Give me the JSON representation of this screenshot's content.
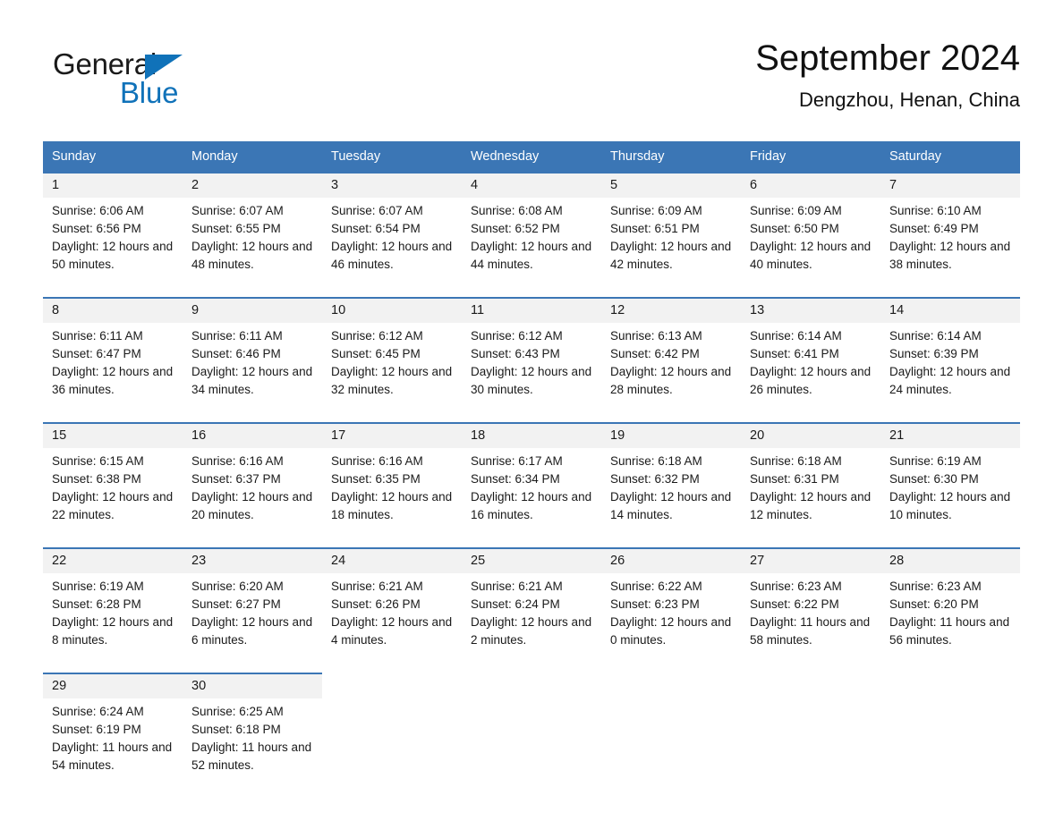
{
  "logo": {
    "word_dark": "General",
    "word_blue": "Blue",
    "triangle_color": "#1072b9"
  },
  "header": {
    "title": "September 2024",
    "subtitle": "Dengzhou, Henan, China"
  },
  "theme": {
    "header_row_bg": "#3b76b5",
    "date_cell_bg": "#f2f2f2",
    "week_rule": "#3b76b5",
    "text": "#1a1a1a"
  },
  "calendar": {
    "weekday_headers": [
      "Sunday",
      "Monday",
      "Tuesday",
      "Wednesday",
      "Thursday",
      "Friday",
      "Saturday"
    ],
    "weeks": [
      [
        {
          "day": "1",
          "sunrise": "Sunrise: 6:06 AM",
          "sunset": "Sunset: 6:56 PM",
          "daylight": "Daylight: 12 hours and 50 minutes."
        },
        {
          "day": "2",
          "sunrise": "Sunrise: 6:07 AM",
          "sunset": "Sunset: 6:55 PM",
          "daylight": "Daylight: 12 hours and 48 minutes."
        },
        {
          "day": "3",
          "sunrise": "Sunrise: 6:07 AM",
          "sunset": "Sunset: 6:54 PM",
          "daylight": "Daylight: 12 hours and 46 minutes."
        },
        {
          "day": "4",
          "sunrise": "Sunrise: 6:08 AM",
          "sunset": "Sunset: 6:52 PM",
          "daylight": "Daylight: 12 hours and 44 minutes."
        },
        {
          "day": "5",
          "sunrise": "Sunrise: 6:09 AM",
          "sunset": "Sunset: 6:51 PM",
          "daylight": "Daylight: 12 hours and 42 minutes."
        },
        {
          "day": "6",
          "sunrise": "Sunrise: 6:09 AM",
          "sunset": "Sunset: 6:50 PM",
          "daylight": "Daylight: 12 hours and 40 minutes."
        },
        {
          "day": "7",
          "sunrise": "Sunrise: 6:10 AM",
          "sunset": "Sunset: 6:49 PM",
          "daylight": "Daylight: 12 hours and 38 minutes."
        }
      ],
      [
        {
          "day": "8",
          "sunrise": "Sunrise: 6:11 AM",
          "sunset": "Sunset: 6:47 PM",
          "daylight": "Daylight: 12 hours and 36 minutes."
        },
        {
          "day": "9",
          "sunrise": "Sunrise: 6:11 AM",
          "sunset": "Sunset: 6:46 PM",
          "daylight": "Daylight: 12 hours and 34 minutes."
        },
        {
          "day": "10",
          "sunrise": "Sunrise: 6:12 AM",
          "sunset": "Sunset: 6:45 PM",
          "daylight": "Daylight: 12 hours and 32 minutes."
        },
        {
          "day": "11",
          "sunrise": "Sunrise: 6:12 AM",
          "sunset": "Sunset: 6:43 PM",
          "daylight": "Daylight: 12 hours and 30 minutes."
        },
        {
          "day": "12",
          "sunrise": "Sunrise: 6:13 AM",
          "sunset": "Sunset: 6:42 PM",
          "daylight": "Daylight: 12 hours and 28 minutes."
        },
        {
          "day": "13",
          "sunrise": "Sunrise: 6:14 AM",
          "sunset": "Sunset: 6:41 PM",
          "daylight": "Daylight: 12 hours and 26 minutes."
        },
        {
          "day": "14",
          "sunrise": "Sunrise: 6:14 AM",
          "sunset": "Sunset: 6:39 PM",
          "daylight": "Daylight: 12 hours and 24 minutes."
        }
      ],
      [
        {
          "day": "15",
          "sunrise": "Sunrise: 6:15 AM",
          "sunset": "Sunset: 6:38 PM",
          "daylight": "Daylight: 12 hours and 22 minutes."
        },
        {
          "day": "16",
          "sunrise": "Sunrise: 6:16 AM",
          "sunset": "Sunset: 6:37 PM",
          "daylight": "Daylight: 12 hours and 20 minutes."
        },
        {
          "day": "17",
          "sunrise": "Sunrise: 6:16 AM",
          "sunset": "Sunset: 6:35 PM",
          "daylight": "Daylight: 12 hours and 18 minutes."
        },
        {
          "day": "18",
          "sunrise": "Sunrise: 6:17 AM",
          "sunset": "Sunset: 6:34 PM",
          "daylight": "Daylight: 12 hours and 16 minutes."
        },
        {
          "day": "19",
          "sunrise": "Sunrise: 6:18 AM",
          "sunset": "Sunset: 6:32 PM",
          "daylight": "Daylight: 12 hours and 14 minutes."
        },
        {
          "day": "20",
          "sunrise": "Sunrise: 6:18 AM",
          "sunset": "Sunset: 6:31 PM",
          "daylight": "Daylight: 12 hours and 12 minutes."
        },
        {
          "day": "21",
          "sunrise": "Sunrise: 6:19 AM",
          "sunset": "Sunset: 6:30 PM",
          "daylight": "Daylight: 12 hours and 10 minutes."
        }
      ],
      [
        {
          "day": "22",
          "sunrise": "Sunrise: 6:19 AM",
          "sunset": "Sunset: 6:28 PM",
          "daylight": "Daylight: 12 hours and 8 minutes."
        },
        {
          "day": "23",
          "sunrise": "Sunrise: 6:20 AM",
          "sunset": "Sunset: 6:27 PM",
          "daylight": "Daylight: 12 hours and 6 minutes."
        },
        {
          "day": "24",
          "sunrise": "Sunrise: 6:21 AM",
          "sunset": "Sunset: 6:26 PM",
          "daylight": "Daylight: 12 hours and 4 minutes."
        },
        {
          "day": "25",
          "sunrise": "Sunrise: 6:21 AM",
          "sunset": "Sunset: 6:24 PM",
          "daylight": "Daylight: 12 hours and 2 minutes."
        },
        {
          "day": "26",
          "sunrise": "Sunrise: 6:22 AM",
          "sunset": "Sunset: 6:23 PM",
          "daylight": "Daylight: 12 hours and 0 minutes."
        },
        {
          "day": "27",
          "sunrise": "Sunrise: 6:23 AM",
          "sunset": "Sunset: 6:22 PM",
          "daylight": "Daylight: 11 hours and 58 minutes."
        },
        {
          "day": "28",
          "sunrise": "Sunrise: 6:23 AM",
          "sunset": "Sunset: 6:20 PM",
          "daylight": "Daylight: 11 hours and 56 minutes."
        }
      ],
      [
        {
          "day": "29",
          "sunrise": "Sunrise: 6:24 AM",
          "sunset": "Sunset: 6:19 PM",
          "daylight": "Daylight: 11 hours and 54 minutes."
        },
        {
          "day": "30",
          "sunrise": "Sunrise: 6:25 AM",
          "sunset": "Sunset: 6:18 PM",
          "daylight": "Daylight: 11 hours and 52 minutes."
        },
        {
          "day": "",
          "sunrise": "",
          "sunset": "",
          "daylight": ""
        },
        {
          "day": "",
          "sunrise": "",
          "sunset": "",
          "daylight": ""
        },
        {
          "day": "",
          "sunrise": "",
          "sunset": "",
          "daylight": ""
        },
        {
          "day": "",
          "sunrise": "",
          "sunset": "",
          "daylight": ""
        },
        {
          "day": "",
          "sunrise": "",
          "sunset": "",
          "daylight": ""
        }
      ]
    ]
  }
}
